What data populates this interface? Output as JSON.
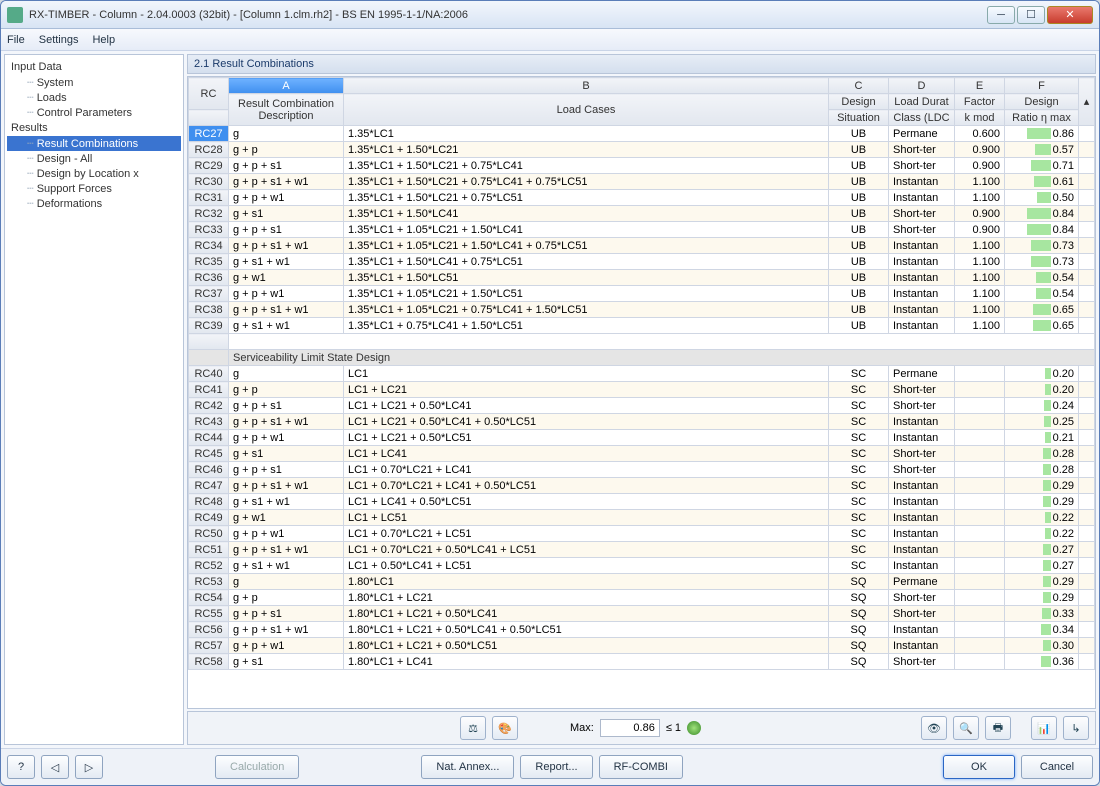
{
  "window": {
    "title": "RX-TIMBER - Column - 2.04.0003 (32bit) - [Column 1.clm.rh2] - BS EN 1995-1-1/NA:2006"
  },
  "menu": {
    "items": [
      "File",
      "Settings",
      "Help"
    ]
  },
  "nav": {
    "group1": "Input Data",
    "items1": [
      "System",
      "Loads",
      "Control Parameters"
    ],
    "group2": "Results",
    "items2": [
      "Result Combinations",
      "Design - All",
      "Design by Location x",
      "Support Forces",
      "Deformations"
    ],
    "selected": "Result Combinations"
  },
  "pane": {
    "title": "2.1 Result Combinations"
  },
  "columns": {
    "abc": [
      "A",
      "B",
      "C",
      "D",
      "E",
      "F"
    ],
    "rc": "RC",
    "desc_h1": "Result Combination",
    "desc_h2": "Description",
    "lc": "Load Cases",
    "dsit": [
      "Design",
      "Situation"
    ],
    "ldc": [
      "Load Durat",
      "Class (LDC"
    ],
    "kmod": [
      "Factor",
      "k mod"
    ],
    "ratio": [
      "Design",
      "Ratio η max"
    ]
  },
  "section_label": "Serviceability Limit State Design",
  "rows": [
    {
      "rc": "RC27",
      "d": "g",
      "lc": "1.35*LC1",
      "s": "UB",
      "c": "Permane",
      "k": "0.600",
      "r": "0.86",
      "sel": true
    },
    {
      "rc": "RC28",
      "d": "g + p",
      "lc": "1.35*LC1 + 1.50*LC21",
      "s": "UB",
      "c": "Short-ter",
      "k": "0.900",
      "r": "0.57"
    },
    {
      "rc": "RC29",
      "d": "g + p + s1",
      "lc": "1.35*LC1 + 1.50*LC21 + 0.75*LC41",
      "s": "UB",
      "c": "Short-ter",
      "k": "0.900",
      "r": "0.71"
    },
    {
      "rc": "RC30",
      "d": "g + p + s1 + w1",
      "lc": "1.35*LC1 + 1.50*LC21 + 0.75*LC41 + 0.75*LC51",
      "s": "UB",
      "c": "Instantan",
      "k": "1.100",
      "r": "0.61"
    },
    {
      "rc": "RC31",
      "d": "g + p + w1",
      "lc": "1.35*LC1 + 1.50*LC21 + 0.75*LC51",
      "s": "UB",
      "c": "Instantan",
      "k": "1.100",
      "r": "0.50"
    },
    {
      "rc": "RC32",
      "d": "g + s1",
      "lc": "1.35*LC1 + 1.50*LC41",
      "s": "UB",
      "c": "Short-ter",
      "k": "0.900",
      "r": "0.84"
    },
    {
      "rc": "RC33",
      "d": "g + p + s1",
      "lc": "1.35*LC1 + 1.05*LC21 + 1.50*LC41",
      "s": "UB",
      "c": "Short-ter",
      "k": "0.900",
      "r": "0.84"
    },
    {
      "rc": "RC34",
      "d": "g + p + s1 + w1",
      "lc": "1.35*LC1 + 1.05*LC21 + 1.50*LC41 + 0.75*LC51",
      "s": "UB",
      "c": "Instantan",
      "k": "1.100",
      "r": "0.73"
    },
    {
      "rc": "RC35",
      "d": "g + s1 + w1",
      "lc": "1.35*LC1 + 1.50*LC41 + 0.75*LC51",
      "s": "UB",
      "c": "Instantan",
      "k": "1.100",
      "r": "0.73"
    },
    {
      "rc": "RC36",
      "d": "g + w1",
      "lc": "1.35*LC1 + 1.50*LC51",
      "s": "UB",
      "c": "Instantan",
      "k": "1.100",
      "r": "0.54"
    },
    {
      "rc": "RC37",
      "d": "g + p + w1",
      "lc": "1.35*LC1 + 1.05*LC21 + 1.50*LC51",
      "s": "UB",
      "c": "Instantan",
      "k": "1.100",
      "r": "0.54"
    },
    {
      "rc": "RC38",
      "d": "g + p + s1 + w1",
      "lc": "1.35*LC1 + 1.05*LC21 + 0.75*LC41 + 1.50*LC51",
      "s": "UB",
      "c": "Instantan",
      "k": "1.100",
      "r": "0.65"
    },
    {
      "rc": "RC39",
      "d": "g + s1 + w1",
      "lc": "1.35*LC1 + 0.75*LC41 + 1.50*LC51",
      "s": "UB",
      "c": "Instantan",
      "k": "1.100",
      "r": "0.65"
    }
  ],
  "rows2": [
    {
      "rc": "RC40",
      "d": "g",
      "lc": "LC1",
      "s": "SC",
      "c": "Permane",
      "k": "",
      "r": "0.20"
    },
    {
      "rc": "RC41",
      "d": "g + p",
      "lc": "LC1 + LC21",
      "s": "SC",
      "c": "Short-ter",
      "k": "",
      "r": "0.20"
    },
    {
      "rc": "RC42",
      "d": "g + p + s1",
      "lc": "LC1 + LC21 + 0.50*LC41",
      "s": "SC",
      "c": "Short-ter",
      "k": "",
      "r": "0.24"
    },
    {
      "rc": "RC43",
      "d": "g + p + s1 + w1",
      "lc": "LC1 + LC21 + 0.50*LC41 + 0.50*LC51",
      "s": "SC",
      "c": "Instantan",
      "k": "",
      "r": "0.25"
    },
    {
      "rc": "RC44",
      "d": "g + p + w1",
      "lc": "LC1 + LC21 + 0.50*LC51",
      "s": "SC",
      "c": "Instantan",
      "k": "",
      "r": "0.21"
    },
    {
      "rc": "RC45",
      "d": "g + s1",
      "lc": "LC1 + LC41",
      "s": "SC",
      "c": "Short-ter",
      "k": "",
      "r": "0.28"
    },
    {
      "rc": "RC46",
      "d": "g + p + s1",
      "lc": "LC1 + 0.70*LC21 + LC41",
      "s": "SC",
      "c": "Short-ter",
      "k": "",
      "r": "0.28"
    },
    {
      "rc": "RC47",
      "d": "g + p + s1 + w1",
      "lc": "LC1 + 0.70*LC21 + LC41 + 0.50*LC51",
      "s": "SC",
      "c": "Instantan",
      "k": "",
      "r": "0.29"
    },
    {
      "rc": "RC48",
      "d": "g + s1 + w1",
      "lc": "LC1 + LC41 + 0.50*LC51",
      "s": "SC",
      "c": "Instantan",
      "k": "",
      "r": "0.29"
    },
    {
      "rc": "RC49",
      "d": "g + w1",
      "lc": "LC1 + LC51",
      "s": "SC",
      "c": "Instantan",
      "k": "",
      "r": "0.22"
    },
    {
      "rc": "RC50",
      "d": "g + p + w1",
      "lc": "LC1 + 0.70*LC21 + LC51",
      "s": "SC",
      "c": "Instantan",
      "k": "",
      "r": "0.22"
    },
    {
      "rc": "RC51",
      "d": "g + p + s1 + w1",
      "lc": "LC1 + 0.70*LC21 + 0.50*LC41 + LC51",
      "s": "SC",
      "c": "Instantan",
      "k": "",
      "r": "0.27"
    },
    {
      "rc": "RC52",
      "d": "g + s1 + w1",
      "lc": "LC1 + 0.50*LC41 + LC51",
      "s": "SC",
      "c": "Instantan",
      "k": "",
      "r": "0.27"
    },
    {
      "rc": "RC53",
      "d": "g",
      "lc": "1.80*LC1",
      "s": "SQ",
      "c": "Permane",
      "k": "",
      "r": "0.29"
    },
    {
      "rc": "RC54",
      "d": "g + p",
      "lc": "1.80*LC1 + LC21",
      "s": "SQ",
      "c": "Short-ter",
      "k": "",
      "r": "0.29"
    },
    {
      "rc": "RC55",
      "d": "g + p + s1",
      "lc": "1.80*LC1 + LC21 + 0.50*LC41",
      "s": "SQ",
      "c": "Short-ter",
      "k": "",
      "r": "0.33"
    },
    {
      "rc": "RC56",
      "d": "g + p + s1 + w1",
      "lc": "1.80*LC1 + LC21 + 0.50*LC41 + 0.50*LC51",
      "s": "SQ",
      "c": "Instantan",
      "k": "",
      "r": "0.34"
    },
    {
      "rc": "RC57",
      "d": "g + p + w1",
      "lc": "1.80*LC1 + LC21 + 0.50*LC51",
      "s": "SQ",
      "c": "Instantan",
      "k": "",
      "r": "0.30"
    },
    {
      "rc": "RC58",
      "d": "g + s1",
      "lc": "1.80*LC1 + LC41",
      "s": "SQ",
      "c": "Short-ter",
      "k": "",
      "r": "0.36"
    }
  ],
  "toolbar": {
    "max_label": "Max:",
    "max_value": "0.86",
    "limit": "≤ 1"
  },
  "footer": {
    "calc": "Calculation",
    "nat": "Nat. Annex...",
    "report": "Report...",
    "combi": "RF-COMBI",
    "ok": "OK",
    "cancel": "Cancel"
  }
}
